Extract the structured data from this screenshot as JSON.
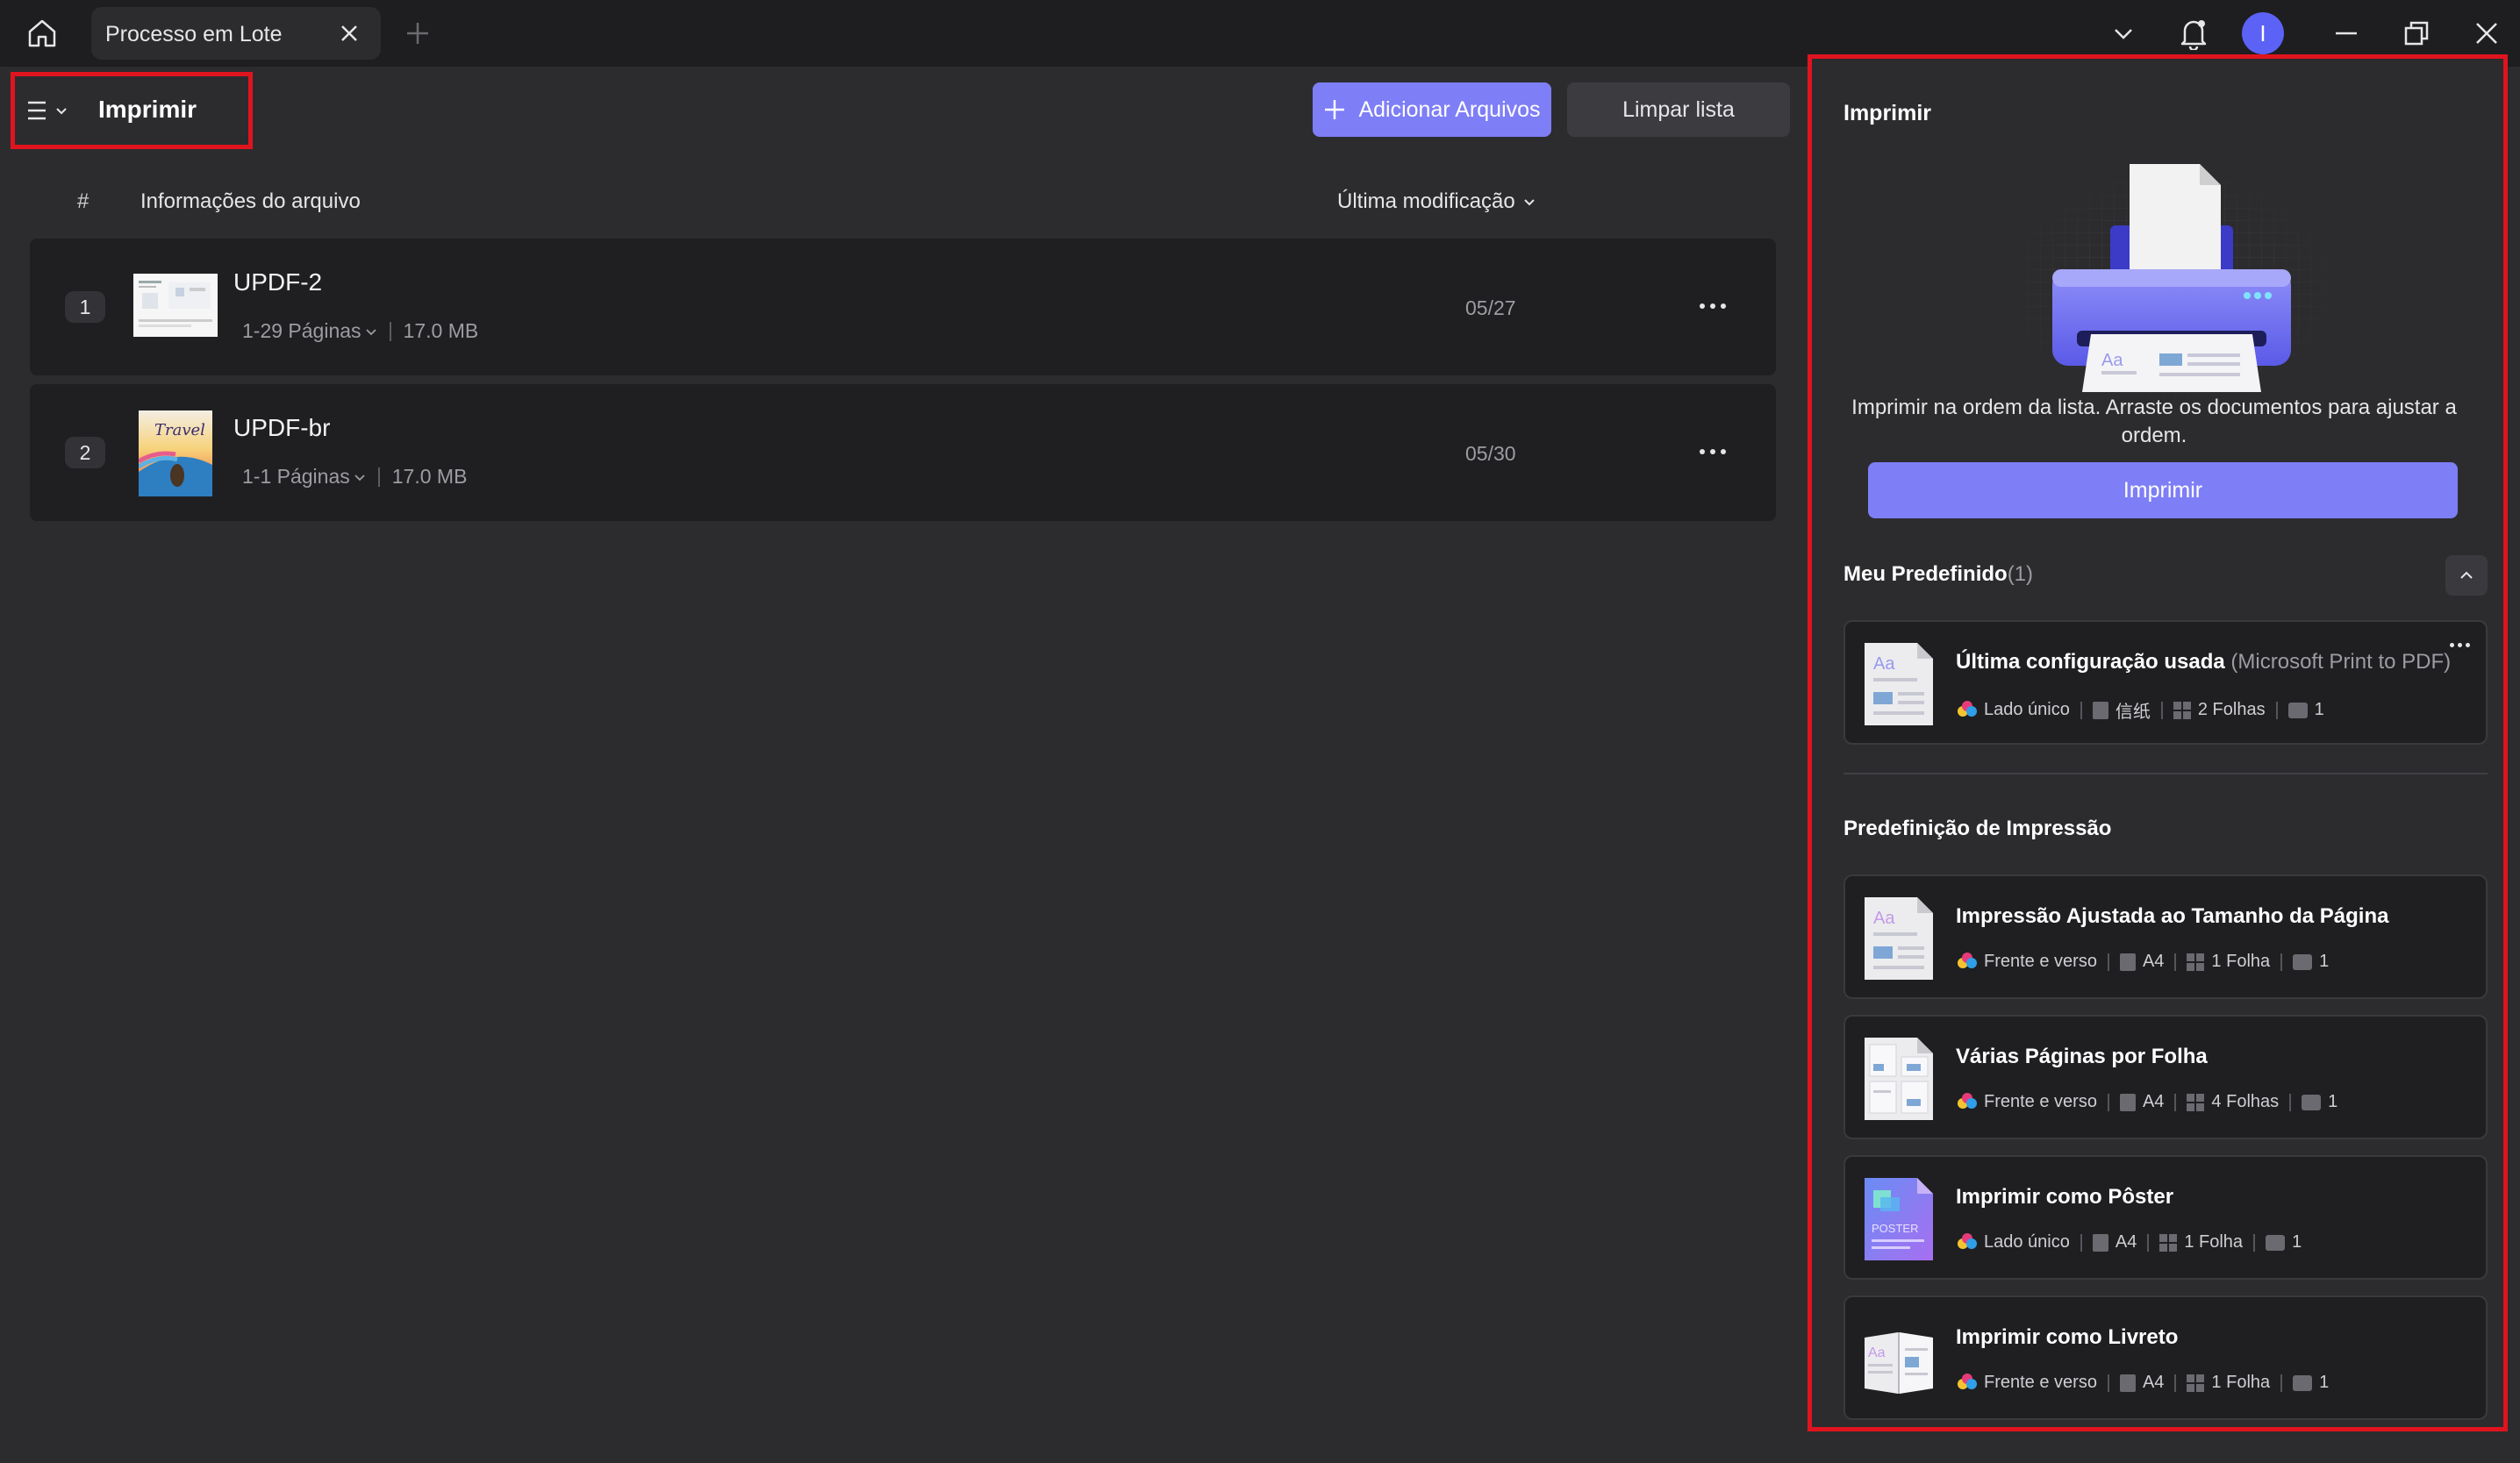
{
  "titlebar": {
    "tab_label": "Processo em Lote",
    "avatar_initial": "I"
  },
  "header": {
    "title": "Imprimir",
    "add_files_label": "Adicionar Arquivos",
    "clear_list_label": "Limpar lista"
  },
  "table": {
    "col_number": "#",
    "col_info": "Informações do arquivo",
    "col_modified": "Última modificação",
    "rows": [
      {
        "num": "1",
        "name": "UPDF-2",
        "pages": "1-29 Páginas",
        "size": "17.0 MB",
        "date": "05/27"
      },
      {
        "num": "2",
        "name": "UPDF-br",
        "pages": "1-1 Páginas",
        "size": "17.0 MB",
        "date": "05/30"
      }
    ]
  },
  "panel": {
    "title": "Imprimir",
    "description": "Imprimir na ordem da lista. Arraste os documentos para ajustar a ordem.",
    "print_button": "Imprimir",
    "my_preset_title": "Meu Predefinido",
    "my_preset_count": "(1)",
    "my_presets": [
      {
        "name": "Última configuração usada",
        "printer": "(Microsoft Print to PDF)",
        "side": "Lado único",
        "paper": "信纸",
        "sheets": "2 Folhas",
        "copies": "1"
      }
    ],
    "print_presets_title": "Predefinição de Impressão",
    "print_presets": [
      {
        "name": "Impressão Ajustada ao Tamanho da Página",
        "side": "Frente e verso",
        "paper": "A4",
        "sheets": "1 Folha",
        "copies": "1"
      },
      {
        "name": "Várias Páginas por Folha",
        "side": "Frente e verso",
        "paper": "A4",
        "sheets": "4 Folhas",
        "copies": "1"
      },
      {
        "name": "Imprimir como Pôster",
        "side": "Lado único",
        "paper": "A4",
        "sheets": "1 Folha",
        "copies": "1",
        "thumb_text": "POSTER"
      },
      {
        "name": "Imprimir como Livreto",
        "side": "Frente e verso",
        "paper": "A4",
        "sheets": "1 Folha",
        "copies": "1"
      }
    ],
    "thumb_glyph": "Aa"
  },
  "thumbs": {
    "travel_text": "Travel"
  },
  "colors": {
    "accent": "#7e7ef7",
    "highlight_border": "#e0141e",
    "background": "#2c2c2f",
    "row_background": "#1f1f22"
  }
}
